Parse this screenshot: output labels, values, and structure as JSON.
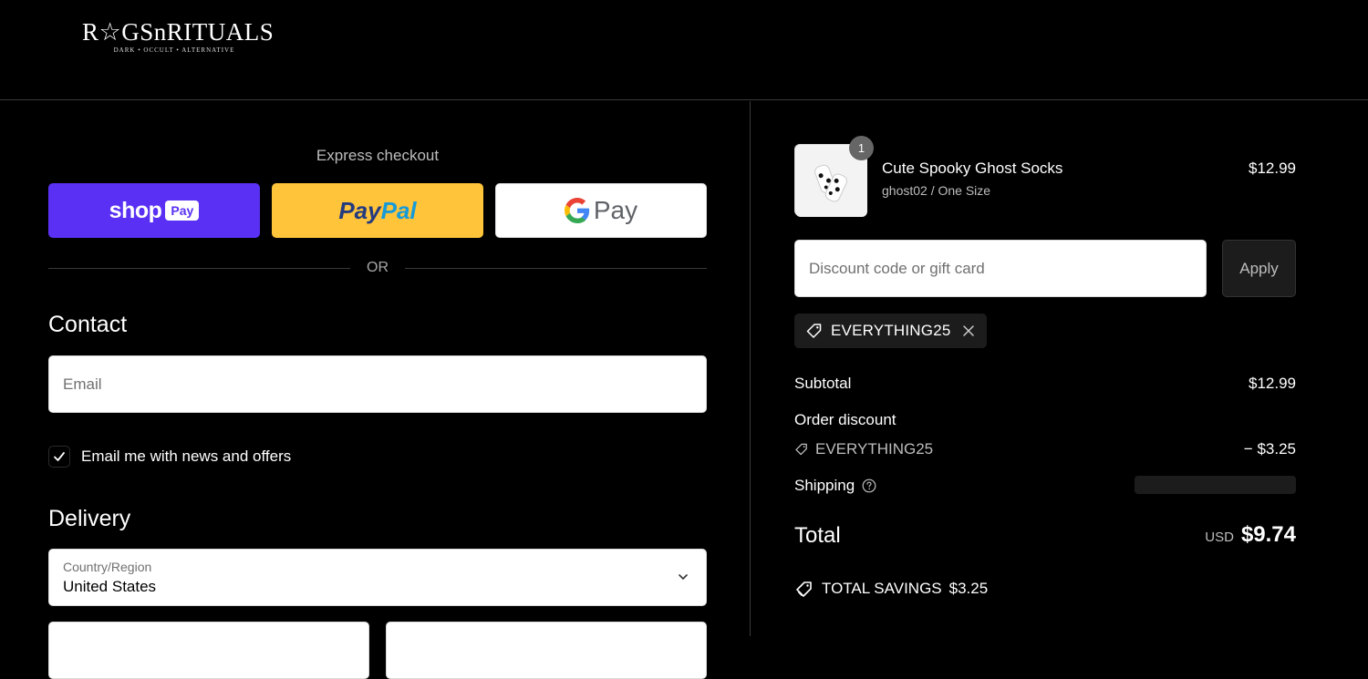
{
  "brand": {
    "name": "R☆GSnRITUALS",
    "tagline": "DARK • OCCULT • ALTERNATIVE"
  },
  "express": {
    "title": "Express checkout",
    "shop_pay": {
      "word": "shop",
      "badge": "Pay",
      "color": "#5a31f4"
    },
    "paypal": {
      "word1": "Pay",
      "word2": "Pal",
      "color": "#ffc439"
    },
    "gpay": {
      "word": "Pay"
    },
    "divider": "OR"
  },
  "contact": {
    "title": "Contact",
    "email_placeholder": "Email",
    "newsletter_label": "Email me with news and offers",
    "newsletter_checked": true
  },
  "delivery": {
    "title": "Delivery",
    "country_label": "Country/Region",
    "country_value": "United States"
  },
  "summary": {
    "product": {
      "name": "Cute Spooky Ghost Socks",
      "variant": "ghost02 / One Size",
      "price": "$12.99",
      "quantity": "1"
    },
    "discount_placeholder": "Discount code or gift card",
    "apply_label": "Apply",
    "applied_code": "EVERYTHING25",
    "subtotal_label": "Subtotal",
    "subtotal_value": "$12.99",
    "order_discount_label": "Order discount",
    "discount_code": "EVERYTHING25",
    "discount_value": "− $3.25",
    "shipping_label": "Shipping",
    "total_label": "Total",
    "total_currency": "USD",
    "total_value": "$9.74",
    "savings_label": "TOTAL SAVINGS",
    "savings_value": "$3.25"
  }
}
